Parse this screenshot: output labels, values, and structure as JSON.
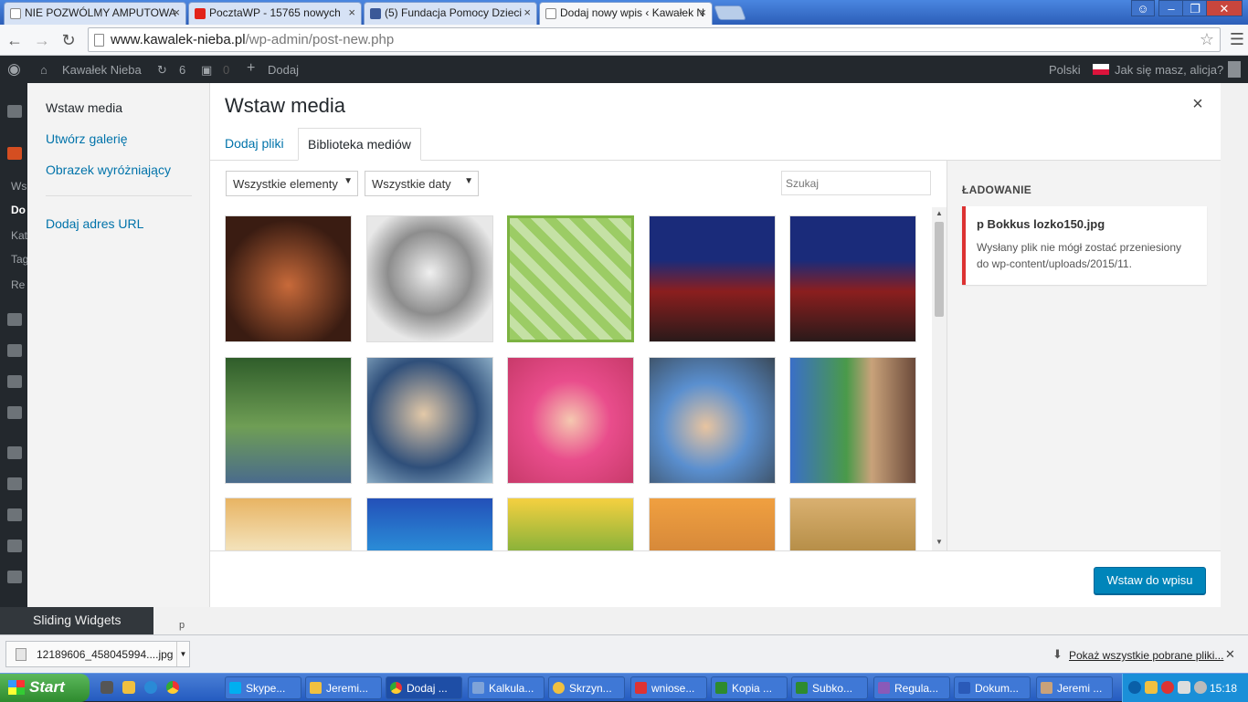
{
  "browser": {
    "tabs": [
      {
        "title": "NIE POZWÓLMY AMPUTOWA",
        "icon": "page-icon"
      },
      {
        "title": "PocztaWP - 15765 nowych",
        "icon": "wp-mail-icon"
      },
      {
        "title": "(5) Fundacja Pomocy Dzieci",
        "icon": "facebook-icon"
      },
      {
        "title": "Dodaj nowy wpis ‹ Kawałek N",
        "icon": "page-icon"
      }
    ],
    "url_domain": "www.kawalek-nieba.pl",
    "url_path": "/wp-admin/post-new.php"
  },
  "adminbar": {
    "site": "Kawałek Nieba",
    "updates": "6",
    "comments": "0",
    "new": "Dodaj",
    "language": "Polski",
    "greeting": "Jak się masz, alicja?"
  },
  "admin_sidebar": {
    "items": [
      "Ws",
      "Do",
      "Kat",
      "Tag",
      "Re"
    ],
    "sliding_widgets": "Sliding Widgets"
  },
  "editor_hint": "p",
  "media_modal": {
    "menu": [
      "Wstaw media",
      "Utwórz galerię",
      "Obrazek wyróżniający",
      "Dodaj adres URL"
    ],
    "title": "Wstaw media",
    "close": "×",
    "tabs": [
      "Dodaj pliki",
      "Biblioteka mediów"
    ],
    "filters": {
      "type": "Wszystkie elementy",
      "date": "Wszystkie daty"
    },
    "search_placeholder": "Szukaj",
    "uploading": {
      "title": "ŁADOWANIE",
      "file": "p Bokkus lozko150.jpg",
      "message": "Wysłany plik nie mógł zostać przeniesiony do wp-content/uploads/2015/11."
    },
    "insert_button": "Wstaw do wpisu"
  },
  "downloads": {
    "file": "12189606_458045994....jpg",
    "show_all": "Pokaż wszystkie pobrane pliki..."
  },
  "taskbar": {
    "start": "Start",
    "items": [
      "Skype...",
      "Jeremi...",
      "Dodaj ...",
      "Kalkula...",
      "Skrzyn...",
      "wniose...",
      "Kopia ...",
      "Subko...",
      "Regula...",
      "Dokum...",
      "Jeremi ..."
    ],
    "clock": "15:18"
  },
  "colors": {
    "accent": "#0085ba",
    "link": "#0073aa",
    "error": "#dc3232",
    "adminbar": "#23282d"
  }
}
